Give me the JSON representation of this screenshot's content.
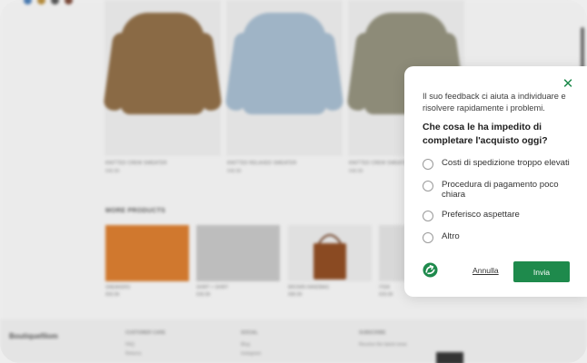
{
  "background": {
    "hero_products": [
      {
        "name": "KNITTED CREW SWEATER",
        "price": "€49.99",
        "color": "#8a6a45"
      },
      {
        "name": "KNITTED RELAXED SWEATER",
        "price": "€49.99",
        "color": "#9fb4c6"
      },
      {
        "name": "KNITTED CREW SWEATER",
        "price": "€49.99",
        "color": "#8d8b78"
      }
    ],
    "section_title": "MORE PRODUCTS",
    "thumbs": [
      {
        "name": "SNEAKERS",
        "price": "€59.99",
        "color": "#d0782e"
      },
      {
        "name": "SHIRT + SHIRT",
        "price": "€39.99",
        "color": "#bdbdbd"
      },
      {
        "name": "BROWN HANDBAG",
        "price": "€89.99",
        "color": "#e0e0e0"
      },
      {
        "name": "ITEM",
        "price": "€29.99",
        "color": "#d8d8d8"
      }
    ],
    "footer": {
      "brand": "Boutiquefilom",
      "col1_title": "CUSTOMER CARE",
      "col1_items": [
        "FAQ",
        "Returns"
      ],
      "col2_title": "SOCIAL",
      "col2_items": [
        "Blog",
        "Instagram"
      ],
      "col3_title": "SUBSCRIBE",
      "col3_text": "Receive the latest news"
    }
  },
  "modal": {
    "intro": "Il suo feedback ci aiuta a individuare e risolvere rapidamente i problemi.",
    "question": "Che cosa le ha impedito di completare l'acquisto oggi?",
    "options": [
      {
        "label": "Costi di spedizione troppo elevati"
      },
      {
        "label": "Procedura di pagamento poco chiara"
      },
      {
        "label": "Preferisco aspettare"
      },
      {
        "label": "Altro"
      }
    ],
    "cancel_label": "Annulla",
    "submit_label": "Invia",
    "close_symbol": "✕",
    "accent_color": "#1e8a4c"
  }
}
